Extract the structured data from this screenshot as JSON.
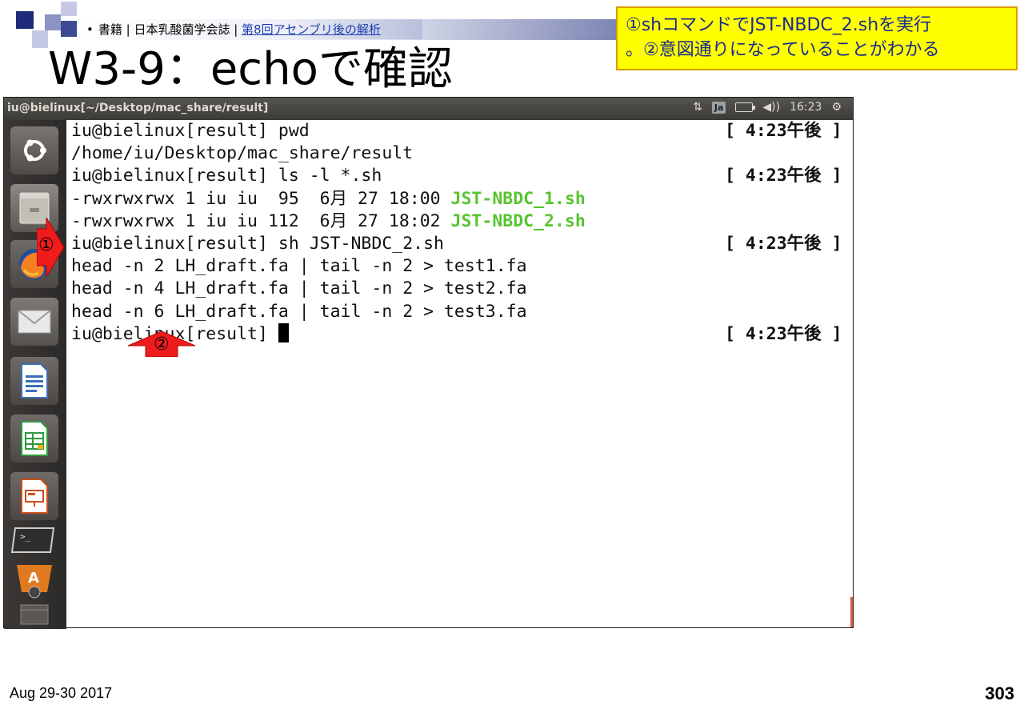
{
  "header": {
    "bullet": "•",
    "breadcrumb_text": "書籍 | 日本乳酸菌学会誌 | ",
    "breadcrumb_link": "第8回アセンブリ後の解析"
  },
  "title": "W3-9：echoで確認",
  "callout": {
    "line1": "①shコマンドでJST-NBDC_2.shを実行",
    "line2": "。②意図通りになっていることがわかる"
  },
  "window": {
    "title": "iu@bielinux[~/Desktop/mac_share/result]",
    "indicators": {
      "network": "⇅",
      "input_method": "Ja",
      "volume": "◀))",
      "clock": "16:23",
      "settings": "⚙"
    }
  },
  "launcher": {
    "items": [
      "dash-home",
      "file-manager",
      "firefox",
      "mail",
      "libreoffice-writer",
      "libreoffice-calc",
      "libreoffice-impress",
      "terminal",
      "software-center"
    ]
  },
  "terminal": {
    "prompt": "iu@bielinux[result]",
    "lines": [
      {
        "pre": "iu@bielinux[result] pwd",
        "green": "",
        "time": "[ 4:23午後 ]"
      },
      {
        "pre": "/home/iu/Desktop/mac_share/result",
        "green": "",
        "time": ""
      },
      {
        "pre": "iu@bielinux[result] ls -l *.sh",
        "green": "",
        "time": "[ 4:23午後 ]"
      },
      {
        "pre": "-rwxrwxrwx 1 iu iu  95  6月 27 18:00 ",
        "green": "JST-NBDC_1.sh",
        "time": ""
      },
      {
        "pre": "-rwxrwxrwx 1 iu iu 112  6月 27 18:02 ",
        "green": "JST-NBDC_2.sh",
        "time": ""
      },
      {
        "pre": "iu@bielinux[result] sh JST-NBDC_2.sh",
        "green": "",
        "time": "[ 4:23午後 ]"
      },
      {
        "pre": "head -n 2 LH_draft.fa | tail -n 2 > test1.fa",
        "green": "",
        "time": ""
      },
      {
        "pre": "head -n 4 LH_draft.fa | tail -n 2 > test2.fa",
        "green": "",
        "time": ""
      },
      {
        "pre": "head -n 6 LH_draft.fa | tail -n 2 > test3.fa",
        "green": "",
        "time": ""
      },
      {
        "pre": "iu@bielinux[result] ",
        "green": "",
        "time": "[ 4:23午後 ]"
      }
    ]
  },
  "annotations": {
    "arrow1": "①",
    "arrow2": "②"
  },
  "footer": {
    "date": "Aug 29-30 2017",
    "page": "303"
  },
  "colors": {
    "callout_bg": "#ffff00",
    "callout_text": "#1a2b8c",
    "green_file": "#57c530",
    "arrow_red": "#ee1c1c"
  }
}
